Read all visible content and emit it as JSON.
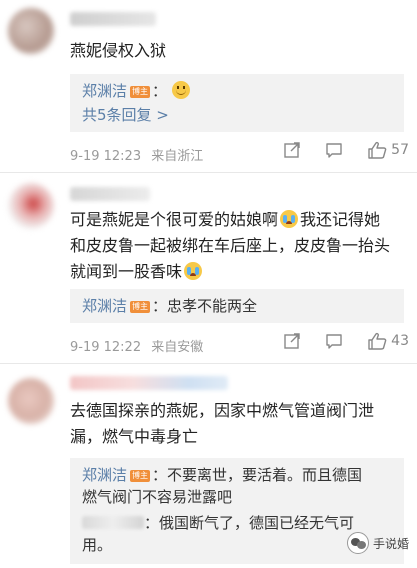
{
  "comments": [
    {
      "text": "燕妮侵权入狱",
      "reply_user": "郑渊洁",
      "badge": "博主",
      "reply_sep": "：",
      "more": "共5条回复 >",
      "time": "9-19 12:23",
      "location": "来自浙江",
      "likes": "57"
    },
    {
      "text_line1": "可是燕妮是个很可爱的姑娘啊",
      "text_line1b": "我还记得她",
      "text_line2": "和皮皮鲁一起被绑在车后座上，皮皮鲁一抬头",
      "text_line3": "就闻到一股香味",
      "reply_user": "郑渊洁",
      "badge": "博主",
      "reply_text": "：忠孝不能两全",
      "time": "9-19 12:22",
      "location": "来自安徽",
      "likes": "43"
    },
    {
      "text_line1": "去德国探亲的燕妮，因家中燃气管道阀门泄",
      "text_line2": "漏，燃气中毒身亡",
      "reply_user": "郑渊洁",
      "badge": "博主",
      "reply_text_line1": "：不要离世，要活着。而且德国",
      "reply_text_line2": "燃气阀门不容易泄露吧",
      "reply2_text_line1": "：俄国断气了，德国已经无气可",
      "reply2_text_line2": "用。"
    }
  ],
  "watermark": "手说婚",
  "colors": {
    "link": "#5b7fa8",
    "badge": "#f08f3a",
    "reply_bg": "#f2f2f2",
    "meta": "#9a9a9a"
  },
  "icons": [
    "share-icon",
    "comment-icon",
    "like-icon",
    "smile-emoji",
    "cry-emoji"
  ]
}
